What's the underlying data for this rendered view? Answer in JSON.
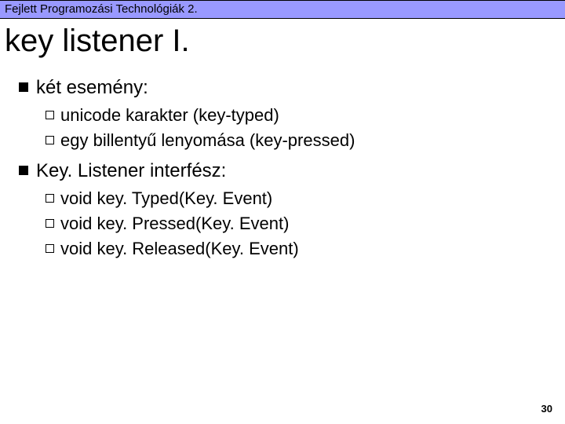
{
  "header": {
    "course": "Fejlett Programozási Technológiák 2."
  },
  "title": "key listener I.",
  "bullets": [
    {
      "text": "két esemény:",
      "children": [
        {
          "text": "unicode karakter (key-typed)"
        },
        {
          "text": "egy billentyű lenyomása (key-pressed)"
        }
      ]
    },
    {
      "text": "Key. Listener interfész:",
      "children": [
        {
          "text": "void key. Typed(Key. Event)"
        },
        {
          "text": "void key. Pressed(Key. Event)"
        },
        {
          "text": "void key. Released(Key. Event)"
        }
      ]
    }
  ],
  "page_number": "30"
}
